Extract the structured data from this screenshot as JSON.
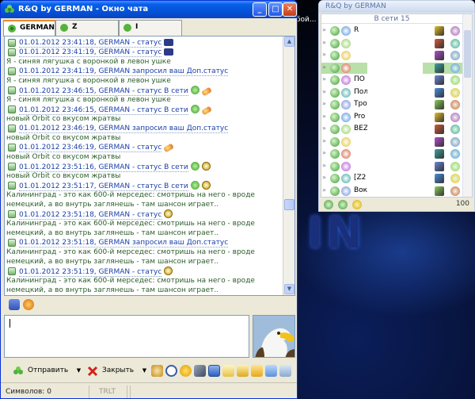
{
  "chat": {
    "title": "R&Q by GERMAN - Окно чата",
    "tabs": [
      {
        "label": "GERMAN"
      },
      {
        "label": "Z"
      },
      {
        "label": "I"
      }
    ],
    "messages": [
      {
        "head": "01.01.2012 23:41:18, GERMAN - статус",
        "icons": [
          "cam"
        ],
        "body": ""
      },
      {
        "head": "01.01.2012 23:41:19, GERMAN - статус",
        "icons": [
          "cam"
        ],
        "body": "Я - синяя лягушка с воронкой в левон ушке"
      },
      {
        "head": "01.01.2012 23:41:19, GERMAN запросил ваш Доп.статус",
        "icons": [],
        "body": "Я - синяя лягушка с воронкой в левон ушке"
      },
      {
        "head": "01.01.2012 23:46:15, GERMAN - статус В сети",
        "icons": [
          "flower",
          "orbit"
        ],
        "body": "Я - синяя лягушка с воронкой в левон ушке"
      },
      {
        "head": "01.01.2012 23:46:15, GERMAN - статус В сети",
        "icons": [
          "flower",
          "orbit"
        ],
        "body": "новый Orbit со вкусом жратвы"
      },
      {
        "head": "01.01.2012 23:46:19, GERMAN запросил ваш Доп.статус",
        "icons": [],
        "body": "новый Orbit со вкусом жратвы"
      },
      {
        "head": "01.01.2012 23:46:19, GERMAN - статус",
        "icons": [
          "orbit"
        ],
        "body": "новый Orbit со вкусом жратвы"
      },
      {
        "head": "01.01.2012 23:51:16, GERMAN - статус В сети",
        "icons": [
          "flower",
          "clock"
        ],
        "body": "новый Orbit со вкусом жратвы"
      },
      {
        "head": "01.01.2012 23:51:17, GERMAN - статус В сети",
        "icons": [
          "flower",
          "clock"
        ],
        "body": "Калининград - это как 600-й мерседес: смотришь на него - вроде немецкий, а во внутрь заглянешь - там шансон играет.."
      },
      {
        "head": "01.01.2012 23:51:18, GERMAN - статус",
        "icons": [
          "clock"
        ],
        "body": "Калининград - это как 600-й мерседес: смотришь на него - вроде немецкий, а во внутрь заглянешь - там шансон играет.."
      },
      {
        "head": "01.01.2012 23:51:18, GERMAN запросил ваш Доп.статус",
        "icons": [],
        "body": "Калининград - это как 600-й мерседес: смотришь на него - вроде немецкий, а во внутрь заглянешь - там шансон играет.."
      },
      {
        "head": "01.01.2012 23:51:19, GERMAN - статус",
        "icons": [
          "clock"
        ],
        "body": "Калининград - это как 600-й мерседес: смотришь на него - вроде немецкий, а во внутрь заглянешь - там шансон играет.."
      }
    ],
    "send_label": "Отправить",
    "close_label": "Закрыть",
    "chars_label": "Символов: 0",
    "translit_label": "TRLT"
  },
  "contact_list": {
    "title": "R&Q by GERMAN",
    "group_label": "В сети 15",
    "contacts": [
      {
        "name": "R"
      },
      {
        "name": ""
      },
      {
        "name": ""
      },
      {
        "name": ""
      },
      {
        "name": "ПО"
      },
      {
        "name": "Пол"
      },
      {
        "name": "Тро"
      },
      {
        "name": "Pro"
      },
      {
        "name": "BEZ"
      },
      {
        "name": ""
      },
      {
        "name": ""
      },
      {
        "name": ""
      },
      {
        "name": "[Z2"
      },
      {
        "name": "Вокруг Света"
      }
    ],
    "count": "100"
  },
  "desktop": {
    "strip_text": "бой...",
    "wallpaper_word": "IN"
  }
}
